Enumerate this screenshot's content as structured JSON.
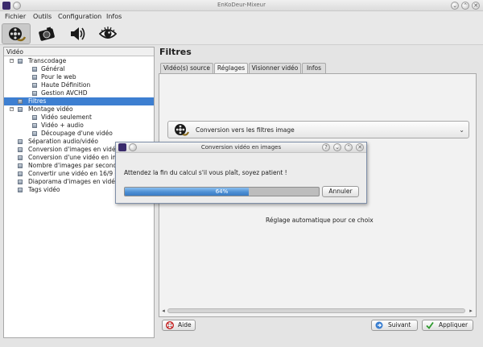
{
  "window": {
    "title": "EnKoDeur-Mixeur"
  },
  "menu": [
    "Fichier",
    "Outils",
    "Configuration",
    "Infos"
  ],
  "toolbar": {
    "buttons": [
      "video-reel-icon",
      "camera-icon",
      "speaker-icon",
      "eye-icon"
    ],
    "active_index": 0
  },
  "tree": {
    "header": "Vidéo",
    "items": [
      {
        "label": "Transcodage",
        "expander": "−",
        "level": 1
      },
      {
        "label": "Général",
        "level": 2
      },
      {
        "label": "Pour le web",
        "level": 2
      },
      {
        "label": "Haute Définition",
        "level": 2
      },
      {
        "label": "Gestion AVCHD",
        "level": 2
      },
      {
        "label": "Filtres",
        "level": 1,
        "selected": true
      },
      {
        "label": "Montage vidéo",
        "expander": "−",
        "level": 1
      },
      {
        "label": "Vidéo seulement",
        "level": 2
      },
      {
        "label": "Vidéo + audio",
        "level": 2
      },
      {
        "label": "Découpage d'une vidéo",
        "level": 2
      },
      {
        "label": "Séparation audio/vidéo",
        "level": 1
      },
      {
        "label": "Conversion d'images en vidéo",
        "level": 1
      },
      {
        "label": "Conversion d'une vidéo en images",
        "level": 1
      },
      {
        "label": "Nombre d'images par seconde",
        "level": 1
      },
      {
        "label": "Convertir une vidéo en 16/9 ou 4/3",
        "level": 1
      },
      {
        "label": "Diaporama d'images en vidéo",
        "level": 1
      },
      {
        "label": "Tags vidéo",
        "level": 1
      }
    ]
  },
  "main": {
    "title": "Filtres",
    "tabs": [
      "Vidéo(s) source",
      "Réglages",
      "Visionner vidéo",
      "Infos"
    ],
    "active_tab": 1,
    "combo_value": "Conversion vers les filtres image",
    "auto_text": "Réglage automatique pour ce choix"
  },
  "buttons": {
    "help": "Aide",
    "next": "Suivant",
    "apply": "Appliquer"
  },
  "dialog": {
    "title": "Conversion vidéo en images",
    "message": "Attendez la fin du calcul s'il vous plaît, soyez patient !",
    "progress_percent": 64,
    "progress_text": "64%",
    "cancel": "Annuler",
    "title_buttons": [
      "?",
      "⌄",
      "⌃",
      "✕"
    ]
  },
  "colors": {
    "selection": "#3d7fd1",
    "progress": "#4d8fd4"
  }
}
